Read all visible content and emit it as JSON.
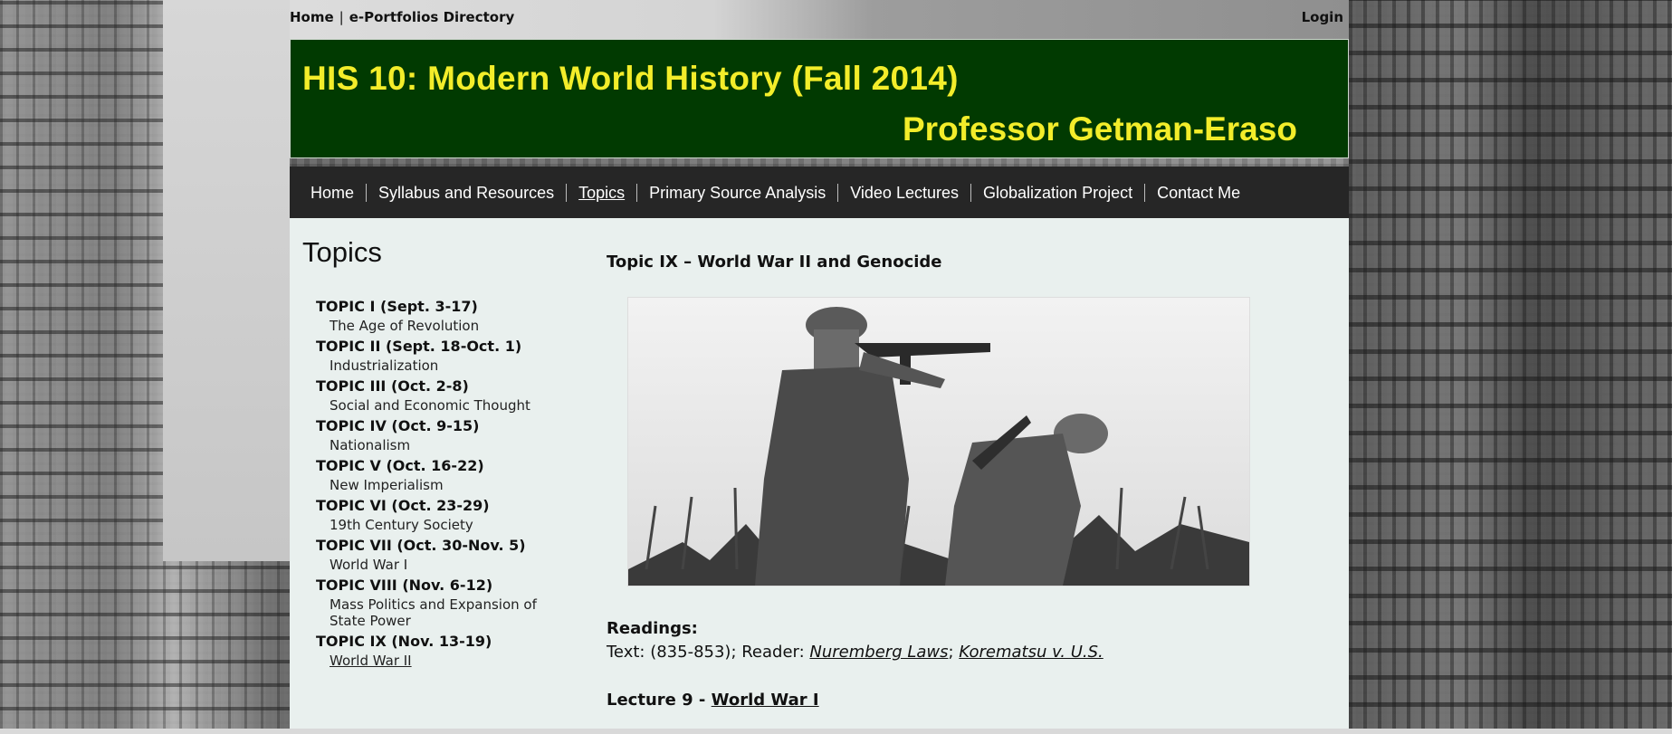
{
  "topbar": {
    "home": "Home",
    "separator": "|",
    "directory": "e-Portfolios Directory",
    "login": "Login"
  },
  "banner": {
    "title": "HIS 10: Modern World History (Fall 2014)",
    "subtitle": "Professor Getman-Eraso"
  },
  "nav": {
    "items": [
      {
        "label": "Home"
      },
      {
        "label": "Syllabus and Resources"
      },
      {
        "label": "Topics",
        "active": true
      },
      {
        "label": "Primary Source Analysis"
      },
      {
        "label": "Video Lectures"
      },
      {
        "label": "Globalization Project"
      },
      {
        "label": "Contact Me"
      }
    ]
  },
  "sidebar": {
    "title": "Topics",
    "topics": [
      {
        "heading": "TOPIC I (Sept. 3-17)",
        "sub": "The Age of Revolution"
      },
      {
        "heading": "TOPIC II (Sept. 18-Oct. 1)",
        "sub": "Industrialization"
      },
      {
        "heading": "TOPIC III (Oct. 2-8)",
        "sub": "Social and Economic Thought"
      },
      {
        "heading": "TOPIC IV (Oct. 9-15)",
        "sub": "Nationalism"
      },
      {
        "heading": "TOPIC V (Oct. 16-22)",
        "sub": "New Imperialism"
      },
      {
        "heading": "TOPIC VI (Oct. 23-29)",
        "sub": "19th Century Society"
      },
      {
        "heading": "TOPIC VII (Oct. 30-Nov. 5)",
        "sub": "World War I"
      },
      {
        "heading": "TOPIC VIII (Nov. 6-12)",
        "sub": "Mass Politics and Expansion of State Power"
      },
      {
        "heading": "TOPIC IX (Nov. 13-19)",
        "sub": "World War II"
      }
    ]
  },
  "main": {
    "heading": "Topic IX – World War II and Genocide",
    "readings_label": "Readings:",
    "readings_prefix": "Text: (835-853); Reader: ",
    "reading_link_1": "Nuremberg Laws",
    "reading_sep": "; ",
    "reading_link_2": "Korematsu v. U.S.",
    "lecture_prefix": "Lecture 9 - ",
    "lecture_link": "World War I"
  },
  "colors": {
    "banner_bg": "#013a01",
    "banner_text": "#f3ed2a",
    "nav_bg": "#262626",
    "content_bg": "#e9f0ee"
  }
}
